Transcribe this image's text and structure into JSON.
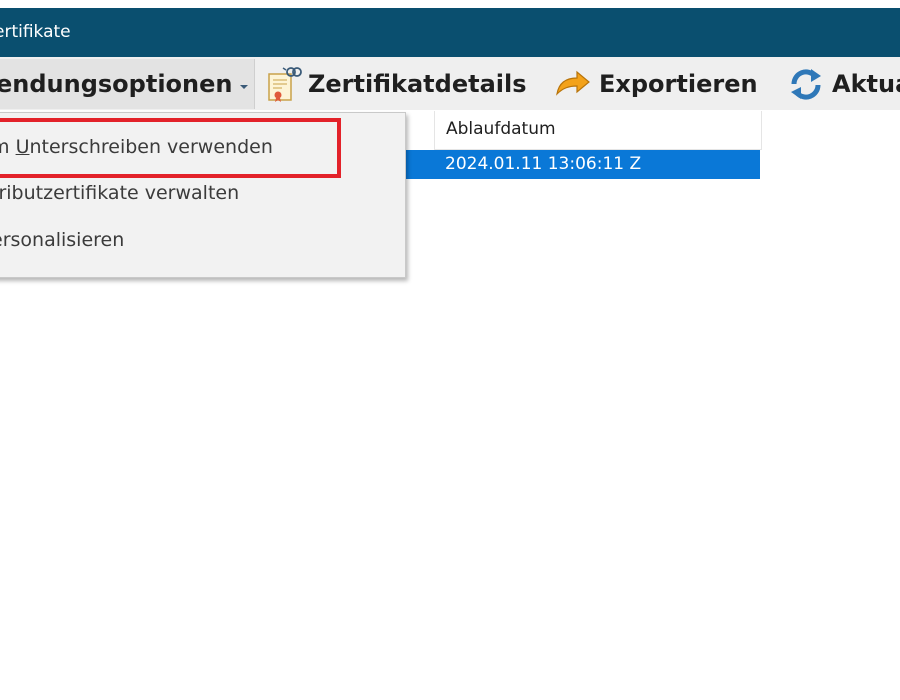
{
  "window": {
    "title": "ertifikate"
  },
  "toolbar": {
    "options_label": "endungsoptionen",
    "details_label": "Zertifikatdetails",
    "export_label": "Exportieren",
    "refresh_label": "Aktua"
  },
  "table": {
    "columns": [
      "Ablaufdatum"
    ],
    "rows": [
      {
        "expiry": "2024.01.11 13:06:11 Z",
        "selected": true
      }
    ]
  },
  "menu": {
    "items": [
      {
        "prefix": "m ",
        "accel": "U",
        "rest": "nterschreiben verwenden"
      },
      {
        "label": "tributzertifikate verwalten"
      },
      {
        "label": "ersonalisieren"
      }
    ]
  },
  "colors": {
    "titlebar": "#0a4f6f",
    "selection": "#0a78d7",
    "highlight": "#e3222a"
  },
  "icons": {
    "options_caret": "chevron-down-icon",
    "details": "certificate-icon",
    "export": "arrow-export-icon",
    "refresh": "refresh-icon"
  }
}
